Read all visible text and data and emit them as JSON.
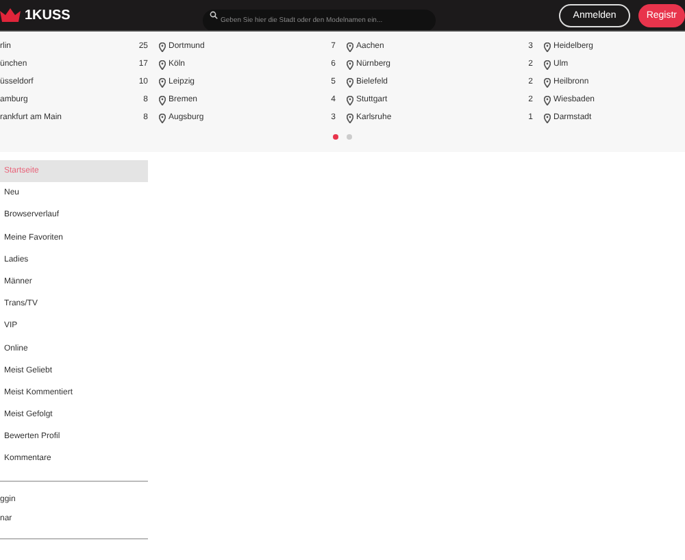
{
  "header": {
    "logo": "1KUSS",
    "search": {
      "placeholder": "Geben Sie hier die Stadt oder den Modelnamen ein..."
    },
    "buttons": [
      {
        "label": "Anmelden",
        "kind": "outline"
      },
      {
        "label": "Registr",
        "kind": "primary"
      }
    ]
  },
  "cities": {
    "columns": [
      {
        "pins": false,
        "items": [
          {
            "name": "rlin",
            "count": "25"
          },
          {
            "name": "ünchen",
            "count": "17"
          },
          {
            "name": "üsseldorf",
            "count": "10"
          },
          {
            "name": "amburg",
            "count": "8"
          },
          {
            "name": "rankfurt am Main",
            "count": "8"
          }
        ]
      },
      {
        "pins": true,
        "items": [
          {
            "name": "Dortmund",
            "count": "7"
          },
          {
            "name": "Köln",
            "count": "6"
          },
          {
            "name": "Leipzig",
            "count": "5"
          },
          {
            "name": "Bremen",
            "count": "4"
          },
          {
            "name": "Augsburg",
            "count": "3"
          }
        ]
      },
      {
        "pins": true,
        "items": [
          {
            "name": "Aachen",
            "count": "3"
          },
          {
            "name": "Nürnberg",
            "count": "2"
          },
          {
            "name": "Bielefeld",
            "count": "2"
          },
          {
            "name": "Stuttgart",
            "count": "2"
          },
          {
            "name": "Karlsruhe",
            "count": "1"
          }
        ]
      },
      {
        "pins": true,
        "items": [
          {
            "name": "Heidelberg"
          },
          {
            "name": "Ulm"
          },
          {
            "name": "Heilbronn"
          },
          {
            "name": "Wiesbaden"
          },
          {
            "name": "Darmstadt"
          }
        ]
      }
    ],
    "pages": [
      {
        "selected": true
      },
      {
        "selected": false
      }
    ]
  },
  "sidebar": {
    "items": [
      {
        "label": "Startseite",
        "selected": true
      },
      {
        "label": "Neu",
        "selected": false
      },
      {
        "label": "Browserverlauf",
        "selected": false
      },
      {
        "label": "Meine Favoriten",
        "selected": false
      },
      {
        "label": "Ladies",
        "selected": false
      },
      {
        "label": "Männer",
        "selected": false
      },
      {
        "label": "Trans/TV",
        "selected": false
      },
      {
        "label": "VIP",
        "selected": false
      },
      {
        "label": "Online",
        "selected": false
      },
      {
        "label": "Meist Geliebt",
        "selected": false
      },
      {
        "label": "Meist Kommentiert",
        "selected": false
      },
      {
        "label": "Meist Gefolgt",
        "selected": false
      },
      {
        "label": "Bewerten Profil",
        "selected": false
      },
      {
        "label": "Kommentare",
        "selected": false
      }
    ],
    "extra": [
      "ggin",
      "nar"
    ]
  }
}
